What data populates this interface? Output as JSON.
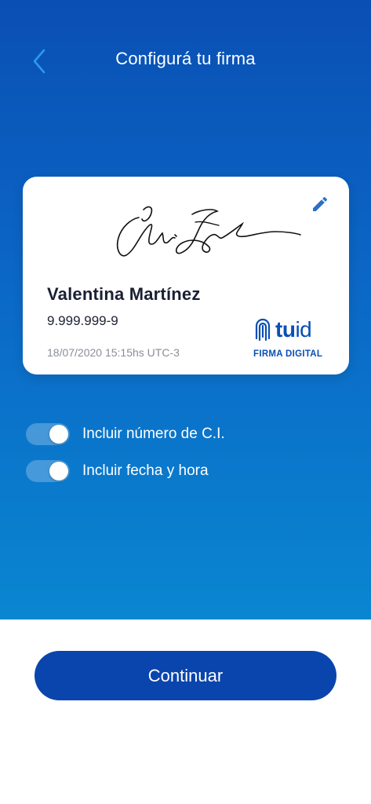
{
  "header": {
    "title": "Configurá tu firma",
    "back_icon": "chevron-left-icon"
  },
  "card": {
    "name": "Valentina Martínez",
    "ci": "9.999.999-9",
    "timestamp": "18/07/2020 15:15hs UTC-3",
    "edit_icon": "pencil-icon",
    "brand": {
      "word_bold": "tu",
      "word_light": "id",
      "subtitle": "FIRMA DIGITAL",
      "color": "#0a4fb4"
    }
  },
  "options": [
    {
      "label": "Incluir número de C.I.",
      "checked": true
    },
    {
      "label": "Incluir fecha y hora",
      "checked": true
    }
  ],
  "footer": {
    "continue_label": "Continuar"
  },
  "colors": {
    "hero_top": "#0a4fb4",
    "hero_bottom": "#0a86d0",
    "button": "#0a45ad",
    "back_icon": "#2a9af0"
  }
}
